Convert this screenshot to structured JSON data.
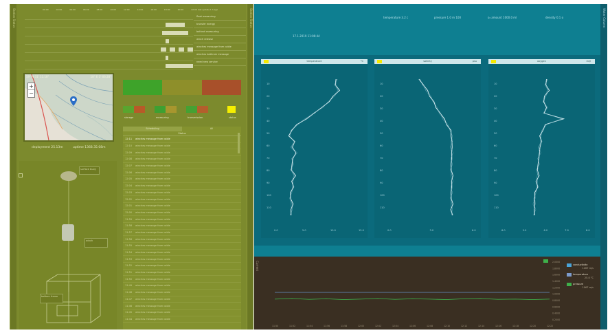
{
  "left_panel": {
    "sidebar_label": "Station Status",
    "right_sidebar_label": "Station Status",
    "schedule": {
      "times": [
        "00:00",
        "02:00",
        "04:00",
        "06:00",
        "08:00",
        "10:00",
        "12:00",
        "14:00",
        "16:00",
        "18:00",
        "20:00",
        "22:00"
      ],
      "header_right": "last update 1 h ago",
      "legend": [
        "float measuring",
        "transfer energy",
        "bathrot measuring",
        "winch release",
        "winches message from cable",
        "winches bathrom message",
        "need new service"
      ]
    },
    "map": {
      "coord_left": "59° N 31' 11.18\"",
      "coord_right": "18° E 3' 06.28\"",
      "zoom_in": "+",
      "zoom_out": "−"
    },
    "deployment": {
      "label": "deployment 25.13m",
      "uptime": "uptime 1368.35.08m"
    },
    "status_tiles": [
      "#3ea32a",
      "#8e8f2a",
      "#a8502a"
    ],
    "status_groups": [
      {
        "label": "storage",
        "colors": [
          "#59a52f",
          "#b85a28"
        ]
      },
      {
        "label": "measuring",
        "colors": [
          "#3da032",
          "#a7962e"
        ]
      },
      {
        "label": "transmission",
        "colors": [
          "#45a133",
          "#b35f2c"
        ]
      },
      {
        "label": "status",
        "colors": [
          "#f6ef00"
        ]
      }
    ],
    "log": {
      "tabs": [
        "Scheduling",
        "All"
      ],
      "column": "Status",
      "first_time": "12:11",
      "first_text": "winches message from cable",
      "entries_text": "winches message from cable",
      "entry_times": [
        "12:10",
        "12:09",
        "12:08",
        "12:07",
        "12:06",
        "12:05",
        "12:04",
        "12:03",
        "12:02",
        "12:01",
        "12:00",
        "11:59",
        "11:58",
        "11:57",
        "11:56",
        "11:55",
        "11:54",
        "11:53",
        "11:52",
        "11:51",
        "11:50",
        "11:49",
        "11:48",
        "11:47",
        "11:46",
        "11:45",
        "11:44"
      ]
    },
    "rig_labels": [
      "surface buoy",
      "winch",
      "bottom frame"
    ]
  },
  "ctd": {
    "sidebar_label": "Water Column",
    "metrics": [
      "temperature 3.2 c",
      "pressure 1.0 m  100",
      "o₂ amount 1000.0 ml",
      "density 0.1 o"
    ],
    "date": "17.1.2019 11:06:44",
    "profiles": [
      {
        "name": "temperature",
        "unit": "°C",
        "x_ticks": [
          "0.0",
          "5.0",
          "10.0",
          "15.0"
        ]
      },
      {
        "name": "salinity",
        "unit": "psu",
        "x_ticks": [
          "0.0",
          "3.0",
          "6.0"
        ]
      },
      {
        "name": "oxygen",
        "unit": "ml/l",
        "x_ticks": [
          "6.0",
          "5.0",
          "6.0",
          "7.0",
          "8.0"
        ]
      }
    ],
    "depth_ticks": [
      "10",
      "20",
      "30",
      "40",
      "50",
      "60",
      "70",
      "80",
      "90",
      "100",
      "110",
      "120",
      "130"
    ]
  },
  "bottom_chart": {
    "label": "Current",
    "x_ticks": [
      "11:50",
      "11:52",
      "11:54",
      "11:56",
      "11:58",
      "12:00",
      "12:02",
      "12:04",
      "12:06",
      "12:08",
      "12:10",
      "12:12",
      "12:14",
      "12:16",
      "12:18",
      "12:20",
      "12:22"
    ],
    "y_ticks": [
      "2.0000",
      "1.8000",
      "1.6000",
      "1.4000",
      "1.2000",
      "1.0000",
      "0.8000",
      "0.6000",
      "0.4000",
      "0.2000"
    ],
    "legend": [
      {
        "name": "conductivity",
        "value": "1267 m/s",
        "color": "#4aa4d8"
      },
      {
        "name": "temperature",
        "value": "25.0 °C",
        "color": "#7d9ccc"
      },
      {
        "name": "pressure",
        "value": "1067 m/s",
        "color": "#3eb04a"
      }
    ],
    "chart_data": {
      "type": "line",
      "x": [
        "11:50",
        "11:52",
        "11:54",
        "11:56",
        "11:58",
        "12:00",
        "12:02",
        "12:04",
        "12:06",
        "12:08",
        "12:10",
        "12:12",
        "12:14",
        "12:16",
        "12:18",
        "12:20",
        "12:22"
      ],
      "ylim": [
        0,
        2
      ],
      "series": [
        {
          "name": "temperature",
          "values": [
            0.95,
            0.95,
            0.95,
            0.95,
            0.95,
            0.95,
            0.95,
            0.95,
            0.95,
            0.95,
            0.95,
            0.95,
            0.95,
            0.95,
            0.95,
            0.95,
            0.95
          ]
        },
        {
          "name": "pressure",
          "values": [
            0.72,
            0.74,
            0.71,
            0.73,
            0.7,
            0.72,
            0.74,
            0.71,
            0.73,
            0.72,
            0.7,
            0.73,
            0.74,
            0.71,
            0.72,
            0.7,
            0.72
          ]
        }
      ]
    }
  }
}
